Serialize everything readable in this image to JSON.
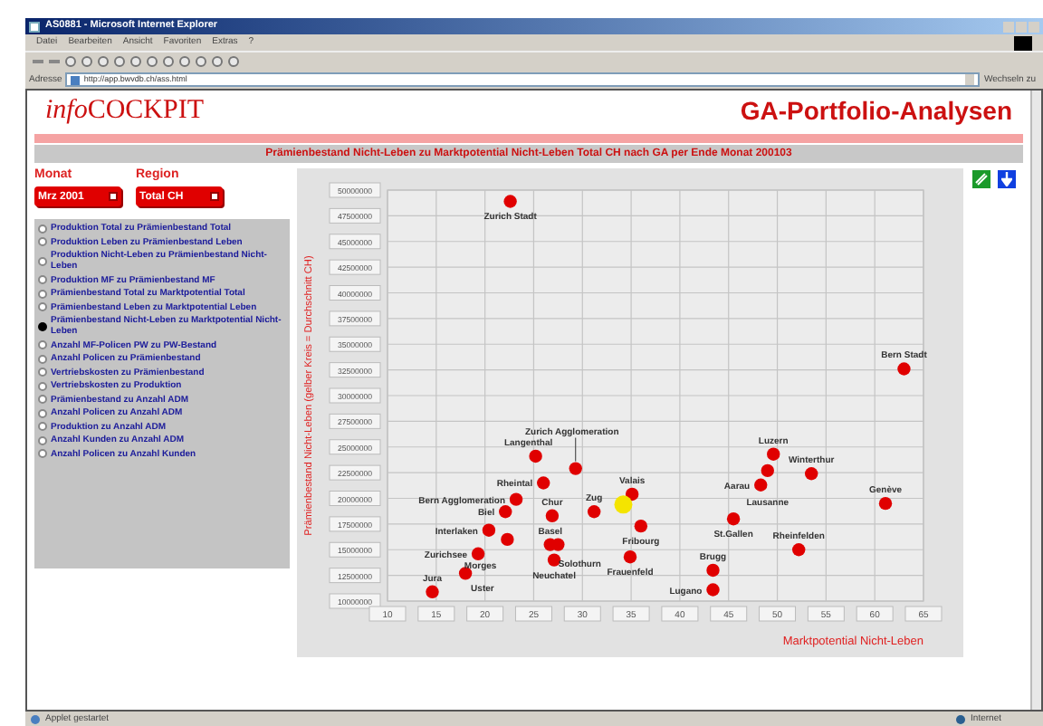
{
  "window": {
    "title": "AS0881 - Microsoft Internet Explorer"
  },
  "menu": [
    "Datei",
    "Bearbeiten",
    "Ansicht",
    "Favoriten",
    "Extras",
    "?"
  ],
  "address_bar": {
    "label": "Adresse",
    "value": "http://app.bwvdb.ch/ass.html",
    "go": "Wechseln zu"
  },
  "page": {
    "logo": {
      "prefix": "info",
      "main": "COCKPIT"
    },
    "heading": "GA-Portfolio-Analysen",
    "report_title": "Prämienbestand Nicht-Leben zu Marktpotential Nicht-Leben Total CH nach GA per Ende Monat 200103",
    "filters": [
      {
        "label": "Monat",
        "value": "Mrz 2001"
      },
      {
        "label": "Region",
        "value": "Total CH"
      }
    ],
    "options": [
      {
        "label": "Produktion Total zu Prämienbestand Total",
        "selected": false
      },
      {
        "label": "Produktion Leben zu Prämienbestand Leben",
        "selected": false
      },
      {
        "label": "Produktion Nicht-Leben zu Prämienbestand Nicht-Leben",
        "selected": false
      },
      {
        "label": "Produktion MF zu Prämienbestand MF",
        "selected": false
      },
      {
        "label": "Prämienbestand Total zu Marktpotential Total",
        "selected": false
      },
      {
        "label": "Prämienbestand Leben zu Marktpotential Leben",
        "selected": false
      },
      {
        "label": "Prämienbestand Nicht-Leben zu Marktpotential Nicht-Leben",
        "selected": true
      },
      {
        "label": "Anzahl MF-Policen PW zu PW-Bestand",
        "selected": false
      },
      {
        "label": "Anzahl Policen zu Prämienbestand",
        "selected": false
      },
      {
        "label": "Vertriebskosten zu Prämienbestand",
        "selected": false
      },
      {
        "label": "Vertriebskosten zu Produktion",
        "selected": false
      },
      {
        "label": "Prämienbestand zu Anzahl ADM",
        "selected": false
      },
      {
        "label": "Anzahl Policen zu Anzahl ADM",
        "selected": false
      },
      {
        "label": "Produktion zu Anzahl ADM",
        "selected": false
      },
      {
        "label": "Anzahl Kunden zu Anzahl ADM",
        "selected": false
      },
      {
        "label": "Anzahl Policen zu Anzahl Kunden",
        "selected": false
      }
    ],
    "chart": {
      "chart_data": {
        "type": "scatter",
        "xlabel": "Marktpotential Nicht-Leben",
        "ylabel": "Prämienbestand Nicht-Leben (gelber Kreis = Durchschnitt CH)",
        "grid": true,
        "xlim": [
          10,
          65
        ],
        "ylim": [
          10000000,
          50000000
        ],
        "xticks": [
          10,
          15,
          20,
          25,
          30,
          35,
          40,
          45,
          50,
          55,
          60,
          65
        ],
        "yticks": [
          {
            "value": 10000000,
            "label": "10000000"
          },
          {
            "value": 12500000,
            "label": "12500000"
          },
          {
            "value": 15000000,
            "label": "15000000"
          },
          {
            "value": 17500000,
            "label": "17500000"
          },
          {
            "value": 20000000,
            "label": "20000000"
          },
          {
            "value": 22500000,
            "label": "22500000"
          },
          {
            "value": 25000000,
            "label": "25000000"
          },
          {
            "value": 27500000,
            "label": "27500000"
          },
          {
            "value": 30000000,
            "label": "30000000"
          },
          {
            "value": 32500000,
            "label": "32500000"
          },
          {
            "value": 35000000,
            "label": "35000000"
          },
          {
            "value": 37500000,
            "label": "37500000"
          },
          {
            "value": 40000000,
            "label": "40000000"
          },
          {
            "value": 42500000,
            "label": "42500000"
          },
          {
            "value": 45000000,
            "label": "45000000"
          },
          {
            "value": 47500000,
            "label": "47500000"
          },
          {
            "value": 50000000,
            "label": "50000000"
          }
        ],
        "series": [
          {
            "color": "#e00000",
            "x": [
              22.6,
              63,
              25.2,
              29.3,
              26,
              23.2,
              26.9,
              22.1,
              20.4,
              26.7,
              22.3,
              27.5,
              19.3,
              18,
              14.6,
              27.1,
              31.2,
              35.1,
              36,
              34.9,
              49.6,
              53.5,
              49,
              48.3,
              61.1,
              45.5,
              52.2,
              43.4,
              43.4
            ],
            "values": [
              48900000,
              32600000,
              24100000,
              22900000,
              21500000,
              19900000,
              18300000,
              18700000,
              16900000,
              15500000,
              16000000,
              15500000,
              14600000,
              12700000,
              10900000,
              14000000,
              18700000,
              20400000,
              17300000,
              14300000,
              24300000,
              22400000,
              22700000,
              21300000,
              19500000,
              18000000,
              15000000,
              13000000,
              11100000
            ]
          },
          {
            "color": "#f4e400",
            "x": [
              34.2
            ],
            "values": [
              19400000
            ]
          }
        ],
        "annotations": [
          {
            "text": "Zurich Stadt",
            "x": 22.6,
            "y": 48900000
          },
          {
            "text": "Bern Stadt",
            "x": 63,
            "y": 32600000
          },
          {
            "text": "Langenthal",
            "x": 25.2,
            "y": 24100000
          },
          {
            "text": "Zurich Agglomeration",
            "x": 29.3,
            "y": 22900000
          },
          {
            "text": "Rheintal",
            "x": 26,
            "y": 21500000
          },
          {
            "text": "Bern Agglomeration",
            "x": 23.2,
            "y": 19900000
          },
          {
            "text": "Chur",
            "x": 26.9,
            "y": 18300000
          },
          {
            "text": "Biel",
            "x": 22.1,
            "y": 18700000
          },
          {
            "text": "Interlaken",
            "x": 20.4,
            "y": 16900000
          },
          {
            "text": "Basel",
            "x": 26.7,
            "y": 15500000
          },
          {
            "text": "Morges",
            "x": 22.3,
            "y": 16000000
          },
          {
            "text": "Solothurn",
            "x": 27.5,
            "y": 15500000
          },
          {
            "text": "Zurichsee",
            "x": 19.3,
            "y": 14600000
          },
          {
            "text": "Uster",
            "x": 18,
            "y": 12700000
          },
          {
            "text": "Jura",
            "x": 14.6,
            "y": 10900000
          },
          {
            "text": "Neuchatel",
            "x": 27.1,
            "y": 14000000
          },
          {
            "text": "Zug",
            "x": 31.2,
            "y": 18700000
          },
          {
            "text": "Valais",
            "x": 35.1,
            "y": 20400000
          },
          {
            "text": "Fribourg",
            "x": 36,
            "y": 17300000
          },
          {
            "text": "Frauenfeld",
            "x": 34.9,
            "y": 14300000
          },
          {
            "text": "Luzern",
            "x": 49.6,
            "y": 24300000
          },
          {
            "text": "Winterthur",
            "x": 53.5,
            "y": 22400000
          },
          {
            "text": "Lausanne",
            "x": 49,
            "y": 22700000
          },
          {
            "text": "Aarau",
            "x": 48.3,
            "y": 21300000
          },
          {
            "text": "Genève",
            "x": 61.1,
            "y": 19500000
          },
          {
            "text": "St.Gallen",
            "x": 45.5,
            "y": 18000000
          },
          {
            "text": "Rheinfelden",
            "x": 52.2,
            "y": 15000000
          },
          {
            "text": "Brugg",
            "x": 43.4,
            "y": 13000000
          },
          {
            "text": "Lugano",
            "x": 43.4,
            "y": 11100000
          }
        ]
      }
    }
  },
  "status_bar": {
    "text": "Applet gestartet",
    "zone": "Internet"
  }
}
